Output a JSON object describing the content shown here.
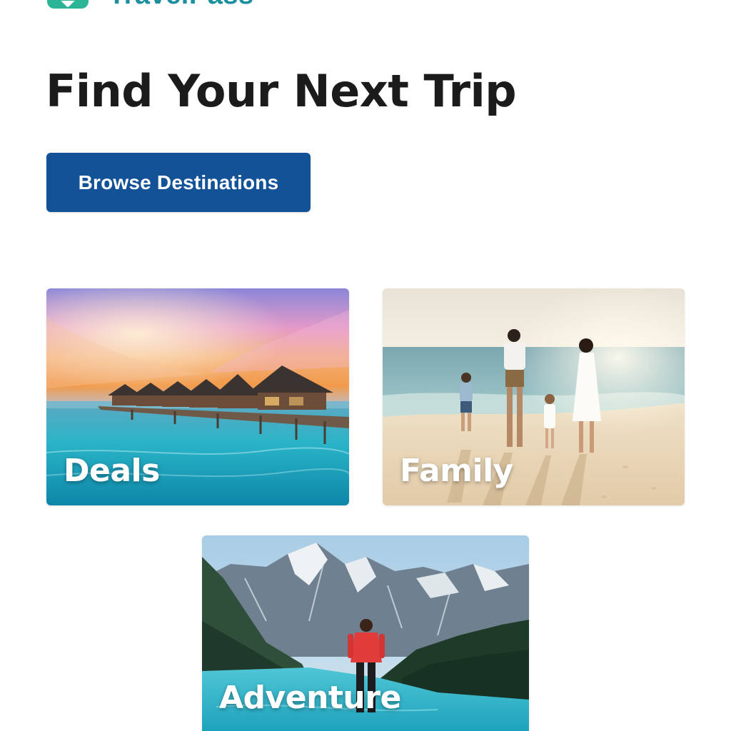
{
  "header": {
    "logo_text": "TravelPass",
    "logo_icon": "map-pin-icon"
  },
  "hero": {
    "title": "Find Your Next Trip",
    "cta_label": "Browse Destinations"
  },
  "categories": [
    {
      "label": "Deals",
      "image": "overwater-bungalows-sunset"
    },
    {
      "label": "Family",
      "image": "family-walking-on-beach"
    },
    {
      "label": "Adventure",
      "image": "hiker-at-mountain-lake"
    }
  ],
  "colors": {
    "brand_teal": "#2bb596",
    "button_blue": "#145297",
    "heading": "#1b1b1b"
  }
}
